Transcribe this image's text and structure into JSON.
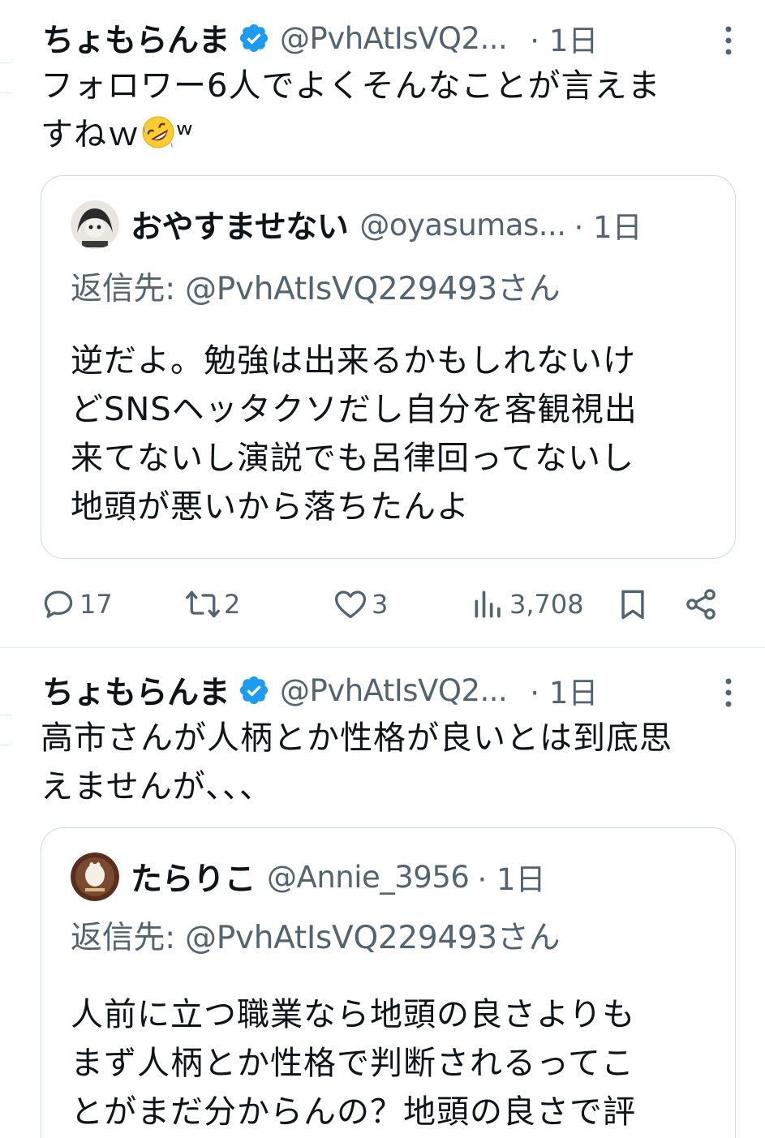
{
  "tweets": [
    {
      "author": "ちょもらんま",
      "handle": "@PvhAtIsVQ2...",
      "time": "· 1日",
      "text_line1": "フォロワー6人でよくそんなことが言えま",
      "text_line2_prefix": "すねｗ",
      "text_line2_suffix": "ʷ",
      "quote": {
        "name": "おやすませない",
        "handle": "@oyasumas...",
        "time": "· 1日",
        "reply_to": "返信先: @PvhAtIsVQ229493さん",
        "lines": [
          "逆だよ。勉強は出来るかもしれないけ",
          "どSNSヘッタクソだし自分を客観視出",
          "来てないし演説でも呂律回ってないし",
          "地頭が悪いから落ちたんよ"
        ]
      },
      "actions": {
        "replies": "17",
        "retweets": "2",
        "likes": "3",
        "views": "3,708"
      }
    },
    {
      "author": "ちょもらんま",
      "handle": "@PvhAtIsVQ2...",
      "time": "· 1日",
      "text_line1": "高市さんが人柄とか性格が良いとは到底思",
      "text_line2": "えませんが、、、",
      "quote": {
        "name": "たらりこ",
        "handle": "@Annie_3956",
        "time": "· 1日",
        "reply_to": "返信先: @PvhAtIsVQ229493さん",
        "lines": [
          "人前に立つ職業なら地頭の良さよりも",
          "まず人柄とか性格で判断されるってこ",
          "とがまだ分からんの？地頭の良さで評"
        ]
      }
    }
  ],
  "colors": {
    "text": "#0f1419",
    "secondary": "#536471",
    "verified": "#1d9bf0",
    "border": "#cfd9de"
  },
  "icons": {
    "verified": "verified-badge-icon",
    "more": "more-vertical-icon",
    "reply": "reply-bubble-icon",
    "retweet": "retweet-icon",
    "like": "heart-icon",
    "views": "views-bar-chart-icon",
    "bookmark": "bookmark-icon",
    "share": "share-icon",
    "emoji": "rolling-on-floor-laughing-emoji"
  }
}
